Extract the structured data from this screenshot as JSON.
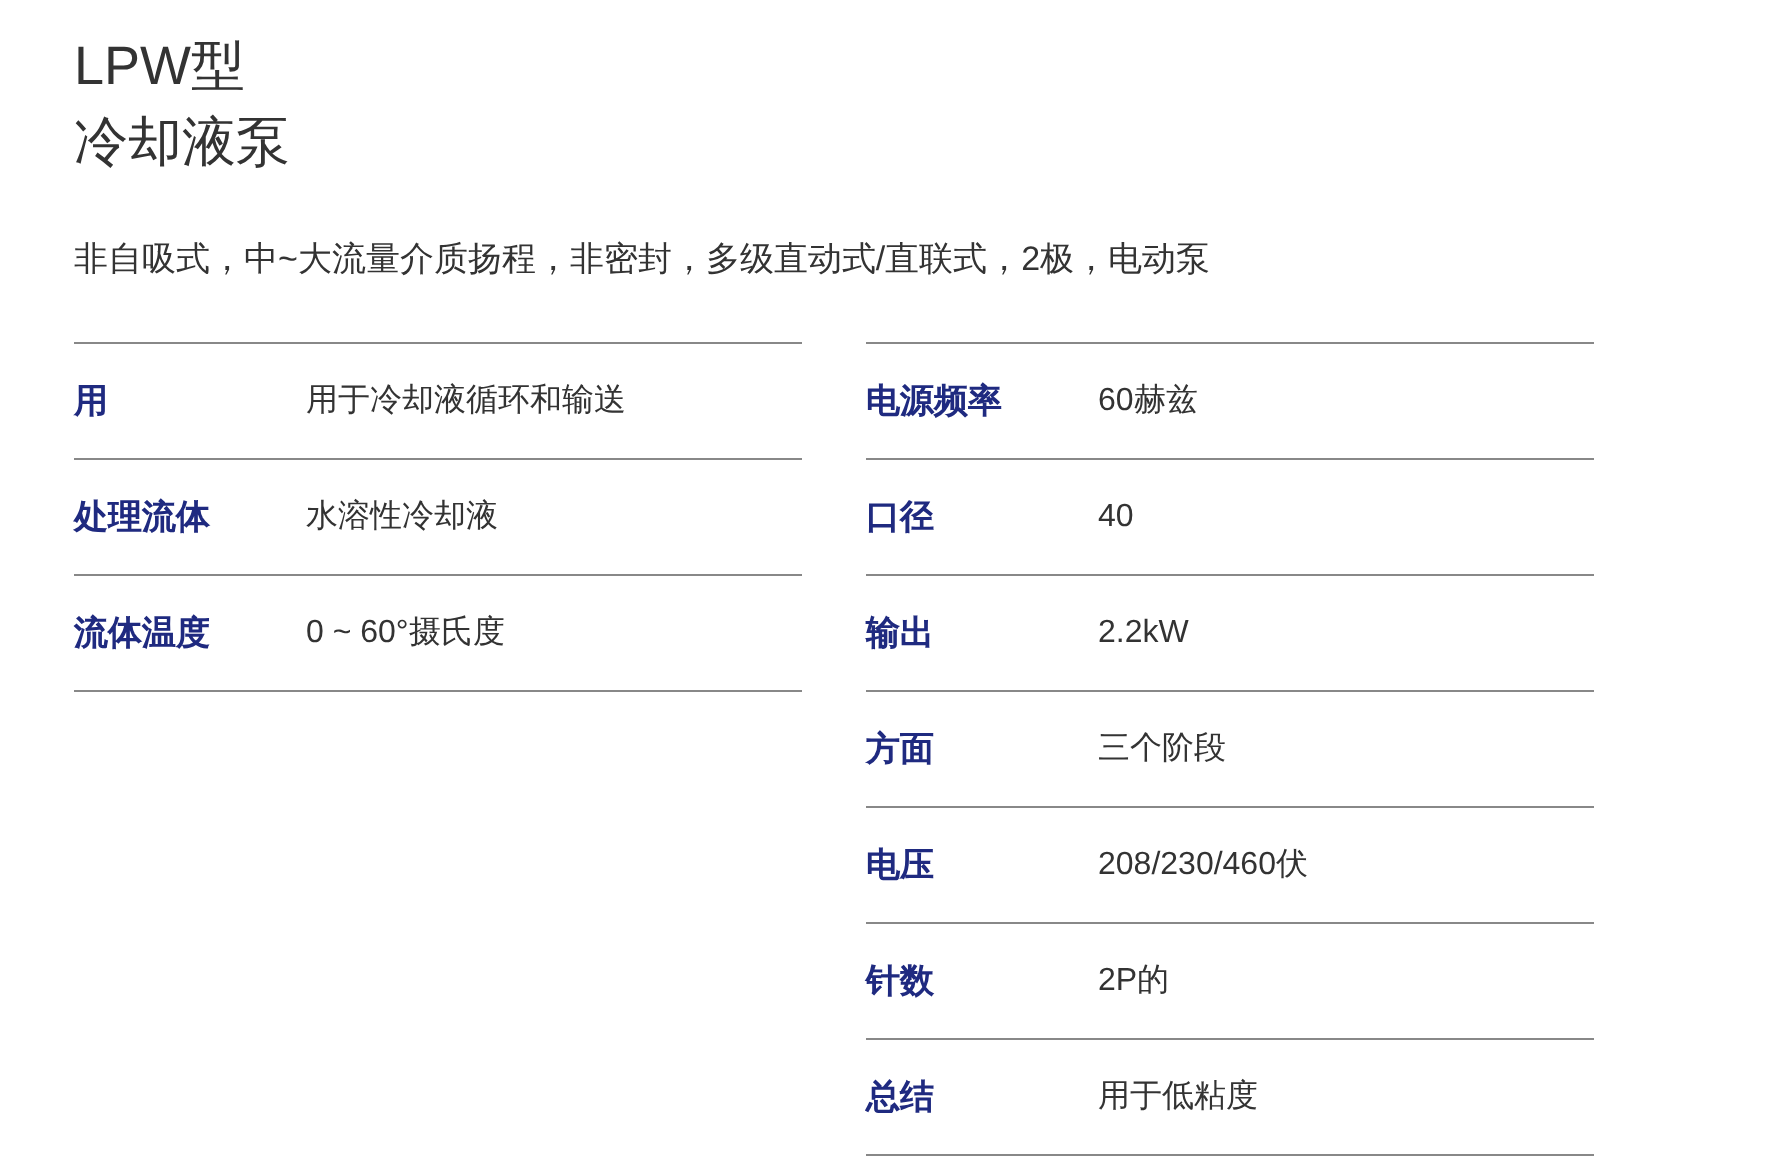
{
  "title": [
    "LPW型",
    "冷却液泵"
  ],
  "description": "非自吸式，中~大流量介质扬程，非密封，多级直动式/直联式，2极，电动泵",
  "left_table": [
    {
      "label": "用",
      "value": "用于冷却液循环和输送"
    },
    {
      "label": "处理流体",
      "value": "水溶性冷却液"
    },
    {
      "label": "流体温度",
      "value": "0 ~ 60°摄氏度"
    }
  ],
  "right_table": [
    {
      "label": "电源频率",
      "value": "60赫兹"
    },
    {
      "label": "口径",
      "value": "40"
    },
    {
      "label": "输出",
      "value": "2.2kW"
    },
    {
      "label": "方面",
      "value": "三个阶段"
    },
    {
      "label": "电压",
      "value": "208/230/460伏"
    },
    {
      "label": "针数",
      "value": "2P的"
    },
    {
      "label": "总结",
      "value": "用于低粘度"
    }
  ]
}
